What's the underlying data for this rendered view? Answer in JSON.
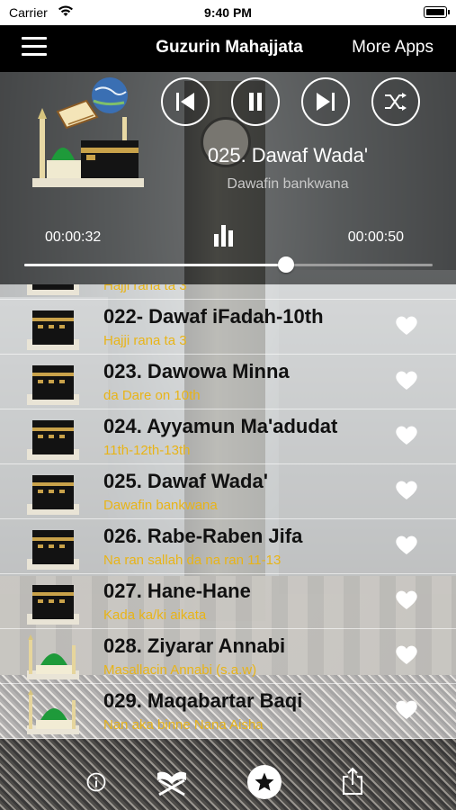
{
  "status_bar": {
    "carrier": "Carrier",
    "time": "9:40 PM"
  },
  "nav": {
    "title": "Guzurin Mahajjata",
    "more_apps": "More Apps"
  },
  "player": {
    "title": "025. Dawaf Wada'",
    "subtitle": "Dawafin bankwana",
    "elapsed": "00:00:32",
    "remaining": "00:00:50",
    "progress_fraction": 0.64
  },
  "tracks": [
    {
      "name": "",
      "desc": "Hajji rana ta 3",
      "icon": "kaaba-icon"
    },
    {
      "name": "022- Dawaf iFadah-10th",
      "desc": "Hajji rana ta 3",
      "icon": "kaaba-icon"
    },
    {
      "name": "023. Dawowa Minna",
      "desc": "da Dare on 10th",
      "icon": "kaaba-icon"
    },
    {
      "name": "024. Ayyamun Ma'adudat",
      "desc": "11th-12th-13th",
      "icon": "kaaba-icon"
    },
    {
      "name": "025. Dawaf Wada'",
      "desc": "Dawafin bankwana",
      "icon": "kaaba-icon"
    },
    {
      "name": "026. Rabe-Raben Jifa",
      "desc": "Na ran sallah da na ran 11-13",
      "icon": "kaaba-icon"
    },
    {
      "name": "027. Hane-Hane",
      "desc": "Kada ka/ki aikata",
      "icon": "kaaba-icon"
    },
    {
      "name": "028. Ziyarar Annabi",
      "desc": "Masallacin Annabi (s.a.w)",
      "icon": "green-dome-icon"
    },
    {
      "name": "029. Maqabartar Baqi",
      "desc": "Nan aka binne Nana Aisha",
      "icon": "green-dome-icon"
    }
  ],
  "colors": {
    "subtitle_yellow": "#e8b418",
    "nav_bg": "#000000"
  }
}
